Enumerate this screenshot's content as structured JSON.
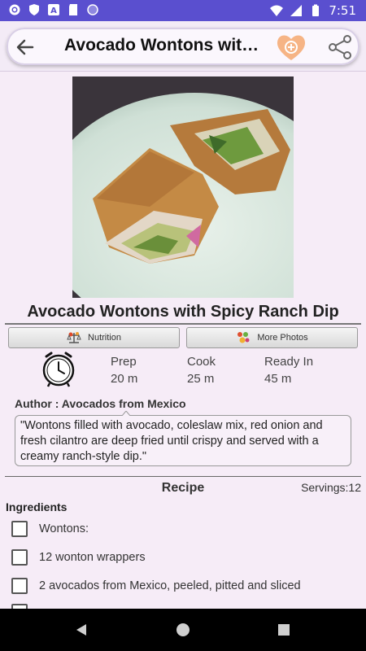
{
  "status_bar": {
    "time": "7:51",
    "icons": [
      "gear-icon",
      "shield-icon",
      "a-icon",
      "sd-card-icon",
      "dot-icon",
      "wifi-icon",
      "signal-icon",
      "battery-icon"
    ]
  },
  "app_bar": {
    "title": "Avocado Wontons wit…",
    "icons": [
      "back-arrow-icon",
      "favorite-add-icon",
      "share-icon"
    ]
  },
  "recipe": {
    "title": "Avocado Wontons with Spicy Ranch Dip",
    "buttons": {
      "nutrition": "Nutrition",
      "more_photos": "More Photos"
    },
    "times": [
      {
        "label": "Prep",
        "value": "20 m"
      },
      {
        "label": "Cook",
        "value": "25 m"
      },
      {
        "label": "Ready In",
        "value": "45 m"
      }
    ],
    "author": "Author : Avocados from Mexico",
    "description": "\"Wontons filled with avocado, coleslaw mix, red onion and fresh cilantro are deep fried until crispy and served with a creamy ranch-style dip.\"",
    "section_title": "Recipe",
    "servings": "Servings:12",
    "ingredients_title": "Ingredients",
    "ingredients": [
      "Wontons:",
      "12 wonton wrappers",
      "2 avocados from Mexico, peeled, pitted and sliced"
    ]
  },
  "colors": {
    "status_bar": "#5a4fcf",
    "background": "#f6ecf7",
    "accent_heart": "#f0a060"
  }
}
